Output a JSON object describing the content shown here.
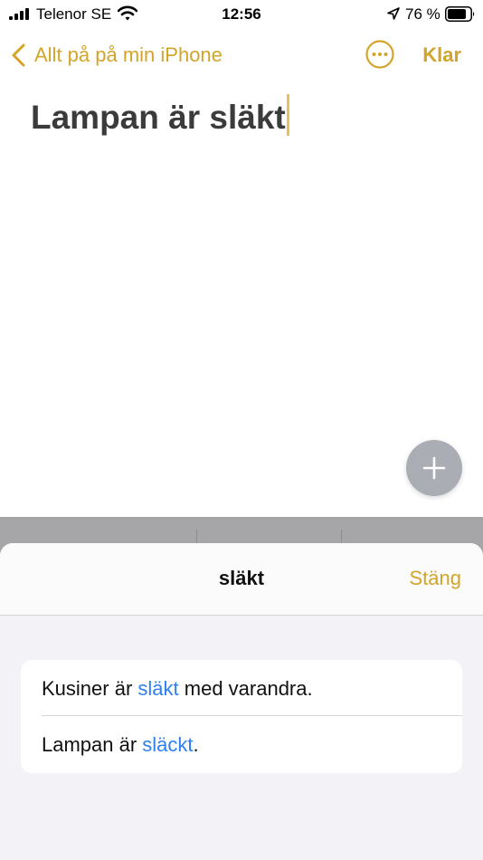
{
  "status_bar": {
    "carrier": "Telenor SE",
    "time": "12:56",
    "battery": "76 %"
  },
  "nav": {
    "back_label": "Allt på på min iPhone",
    "done_label": "Klar"
  },
  "note": {
    "title": "Lampan är släkt"
  },
  "sheet": {
    "title": "släkt",
    "close_label": "Stäng",
    "suggestions": [
      {
        "before": "Kusiner är ",
        "highlight": "släkt",
        "after": " med varandra."
      },
      {
        "before": "Lampan är ",
        "highlight": "släckt",
        "after": "."
      }
    ]
  },
  "colors": {
    "accent": "#d2a52a",
    "link": "#2f7ff0"
  }
}
